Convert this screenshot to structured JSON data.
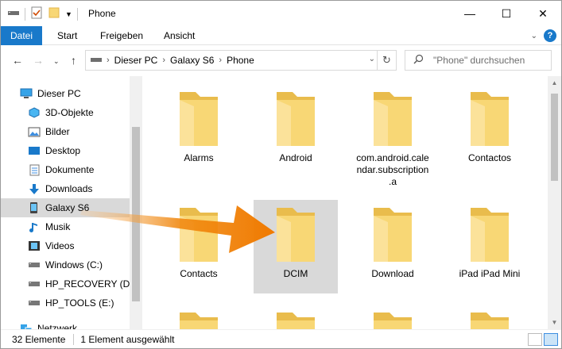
{
  "window": {
    "title": "Phone",
    "controls": {
      "minimize": "—",
      "maximize": "☐",
      "close": "✕"
    }
  },
  "ribbon": {
    "tabs": [
      "Datei",
      "Start",
      "Freigeben",
      "Ansicht"
    ],
    "active_tab": "Datei",
    "help": "?"
  },
  "address": {
    "crumbs": [
      "Dieser PC",
      "Galaxy S6",
      "Phone"
    ],
    "search_placeholder": "\"Phone\" durchsuchen"
  },
  "nav": {
    "items": [
      {
        "label": "Dieser PC",
        "icon": "computer-icon",
        "indent": 0
      },
      {
        "label": "3D-Objekte",
        "icon": "3d-objects-icon",
        "indent": 1
      },
      {
        "label": "Bilder",
        "icon": "pictures-icon",
        "indent": 1
      },
      {
        "label": "Desktop",
        "icon": "desktop-icon",
        "indent": 1
      },
      {
        "label": "Dokumente",
        "icon": "documents-icon",
        "indent": 1
      },
      {
        "label": "Downloads",
        "icon": "downloads-icon",
        "indent": 1
      },
      {
        "label": "Galaxy S6",
        "icon": "phone-icon",
        "indent": 1,
        "selected": true
      },
      {
        "label": "Musik",
        "icon": "music-icon",
        "indent": 1
      },
      {
        "label": "Videos",
        "icon": "videos-icon",
        "indent": 1
      },
      {
        "label": "Windows (C:)",
        "icon": "drive-icon",
        "indent": 1
      },
      {
        "label": "HP_RECOVERY (D:)",
        "icon": "drive-icon",
        "indent": 1
      },
      {
        "label": "HP_TOOLS (E:)",
        "icon": "drive-icon",
        "indent": 1
      },
      {
        "label": "Netzwerk",
        "icon": "network-icon",
        "indent": 0
      }
    ]
  },
  "folders": [
    {
      "label": "Alarms"
    },
    {
      "label": "Android"
    },
    {
      "label": "com.android.calendar.subscription.a",
      "display": [
        "com.android.cale",
        "ndar.subscription",
        ".a"
      ]
    },
    {
      "label": "Contactos"
    },
    {
      "label": "Contacts"
    },
    {
      "label": "DCIM",
      "selected": true
    },
    {
      "label": "Download"
    },
    {
      "label": "iPad iPad Mini"
    }
  ],
  "status": {
    "count": "32 Elemente",
    "selection": "1 Element ausgewählt"
  },
  "colors": {
    "accent": "#1979ca",
    "folder": "#f8d775",
    "folder_dark": "#e9bc4c",
    "annotation_arrow": "#f0850a"
  }
}
